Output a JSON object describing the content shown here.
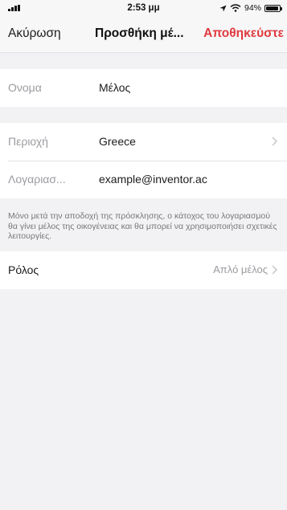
{
  "status_bar": {
    "time": "2:53 μμ",
    "battery_text": "94%",
    "battery_level": 0.94
  },
  "nav": {
    "cancel_label": "Ακύρωση",
    "title": "Προσθήκη μέ...",
    "save_label": "Αποθηκεύστε"
  },
  "form": {
    "name_label": "Ονομα",
    "name_value": "Μέλος",
    "region_label": "Περιοχή",
    "region_value": "Greece",
    "account_label": "Λογαριασ...",
    "account_value": "example@inventor.ac",
    "note": "Μόνο μετά την αποδοχή της πρόσκλησης, ο κάτοχος του λογαριασμού θα γίνει μέλος της οικογένειας και θα μπορεί να χρησιμοποιήσει σχετικές λειτουργίες.",
    "role_label": "Ρόλος",
    "role_value": "Απλό μέλος"
  },
  "colors": {
    "accent": "#e03a3e",
    "background": "#f2f2f4"
  },
  "icons": [
    "signal-icon",
    "location-arrow-icon",
    "wifi-icon",
    "battery-icon",
    "chevron-right-icon"
  ]
}
